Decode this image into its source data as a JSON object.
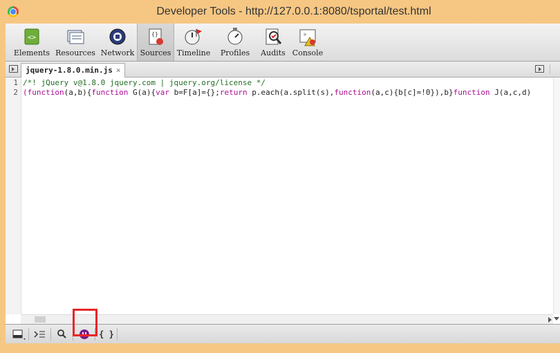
{
  "window": {
    "title": "Developer Tools - http://127.0.0.1:8080/tsportal/test.html"
  },
  "toolbar": {
    "items": [
      {
        "label": "Elements",
        "icon": "elements-icon"
      },
      {
        "label": "Resources",
        "icon": "resources-icon"
      },
      {
        "label": "Network",
        "icon": "network-icon"
      },
      {
        "label": "Sources",
        "icon": "sources-icon",
        "selected": true
      },
      {
        "label": "Timeline",
        "icon": "timeline-icon"
      },
      {
        "label": "Profiles",
        "icon": "profiles-icon"
      },
      {
        "label": "Audits",
        "icon": "audits-icon"
      },
      {
        "label": "Console",
        "icon": "console-icon"
      }
    ]
  },
  "tabs": {
    "file_name": "jquery-1.8.0.min.js",
    "close": "×"
  },
  "editor": {
    "line_numbers": [
      "1",
      "2"
    ],
    "line1": "/*! jQuery v@1.8.0 jquery.com | jquery.org/license */",
    "line2_parts": {
      "p1": "(",
      "k1": "function",
      "p2": "(a,b){",
      "k2": "function",
      "p3": " G(a){",
      "k3": "var",
      "p4": " b=F[a]={};",
      "k4": "return",
      "p5": " p.each(a.split(s),",
      "k5": "function",
      "p6": "(a,c){b[c]=!0}),b}",
      "k6": "function",
      "p7": " J(a,c,d)"
    }
  },
  "statusbar": {
    "pretty_print": "{ }"
  },
  "colors": {
    "frame": "#f6c783",
    "comment": "#236e25",
    "keyword": "#aa0d91",
    "highlight": "#e8262a",
    "pause": "#7a1a8a"
  }
}
